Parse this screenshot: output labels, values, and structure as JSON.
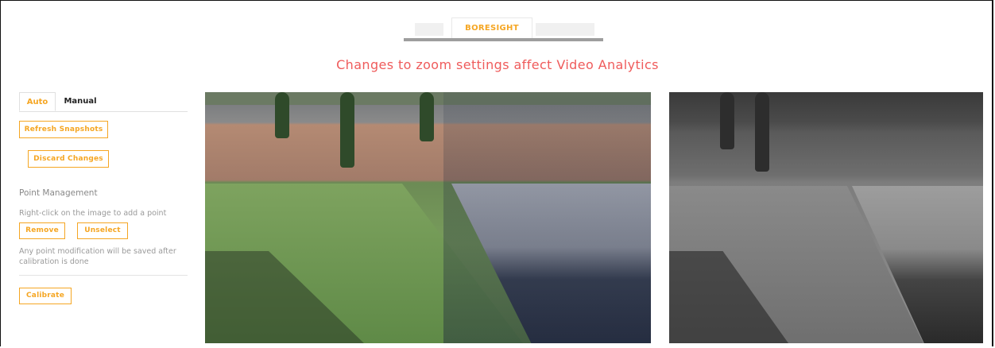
{
  "tabs": {
    "active_label": "BORESIGHT"
  },
  "warning": "Changes to zoom settings affect Video Analytics",
  "panel": {
    "mode_tabs": [
      "Auto",
      "Manual"
    ],
    "refresh_label": "Refresh Snapshots",
    "discard_label": "Discard Changes",
    "point_management_title": "Point Management",
    "point_hint": "Right-click on the image to add a point",
    "remove_label": "Remove",
    "unselect_label": "Unselect",
    "save_note": "Any point modification will be saved after calibration is done",
    "calibrate_label": "Calibrate"
  },
  "colors": {
    "accent": "#f5a623",
    "warning": "#ef5b5b",
    "muted_text": "#9a9a9a"
  },
  "snapshots": {
    "visible_camera": "color camera snapshot",
    "thermal_camera": "grayscale camera snapshot"
  }
}
